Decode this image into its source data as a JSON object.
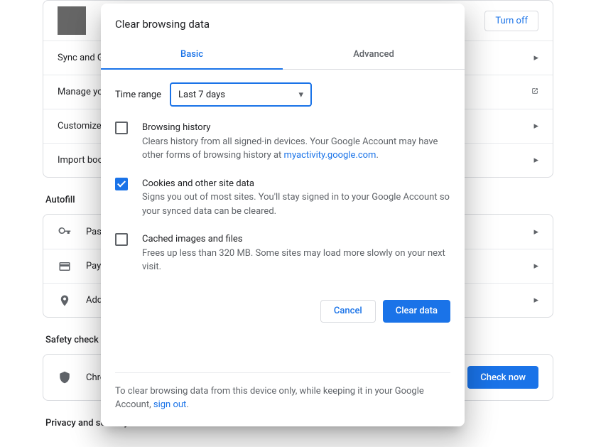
{
  "background": {
    "turn_off": "Turn off",
    "rows1": [
      "Sync and Google services",
      "Manage your Google Account",
      "Customize profile",
      "Import bookmarks and settings"
    ],
    "autofill_title": "Autofill",
    "autofill_rows": [
      "Passwords",
      "Payment methods",
      "Addresses and more"
    ],
    "safety_title": "Safety check",
    "safety_text": "Chrome can help keep you safe from data breaches, bad extensions, and more",
    "check_now": "Check now",
    "privacy_title": "Privacy and security"
  },
  "dialog": {
    "title": "Clear browsing data",
    "tabs": {
      "basic": "Basic",
      "advanced": "Advanced"
    },
    "time_label": "Time range",
    "time_value": "Last 7 days",
    "opts": [
      {
        "title": "Browsing history",
        "checked": false,
        "desc_pre": "Clears history from all signed-in devices. Your Google Account may have other forms of browsing history at ",
        "link": "myactivity.google.com",
        "desc_post": "."
      },
      {
        "title": "Cookies and other site data",
        "checked": true,
        "desc": "Signs you out of most sites. You'll stay signed in to your Google Account so your synced data can be cleared."
      },
      {
        "title": "Cached images and files",
        "checked": false,
        "desc": "Frees up less than 320 MB. Some sites may load more slowly on your next visit."
      }
    ],
    "cancel": "Cancel",
    "clear": "Clear data",
    "footer_pre": "To clear browsing data from this device only, while keeping it in your Google Account, ",
    "footer_link": "sign out",
    "footer_post": "."
  }
}
